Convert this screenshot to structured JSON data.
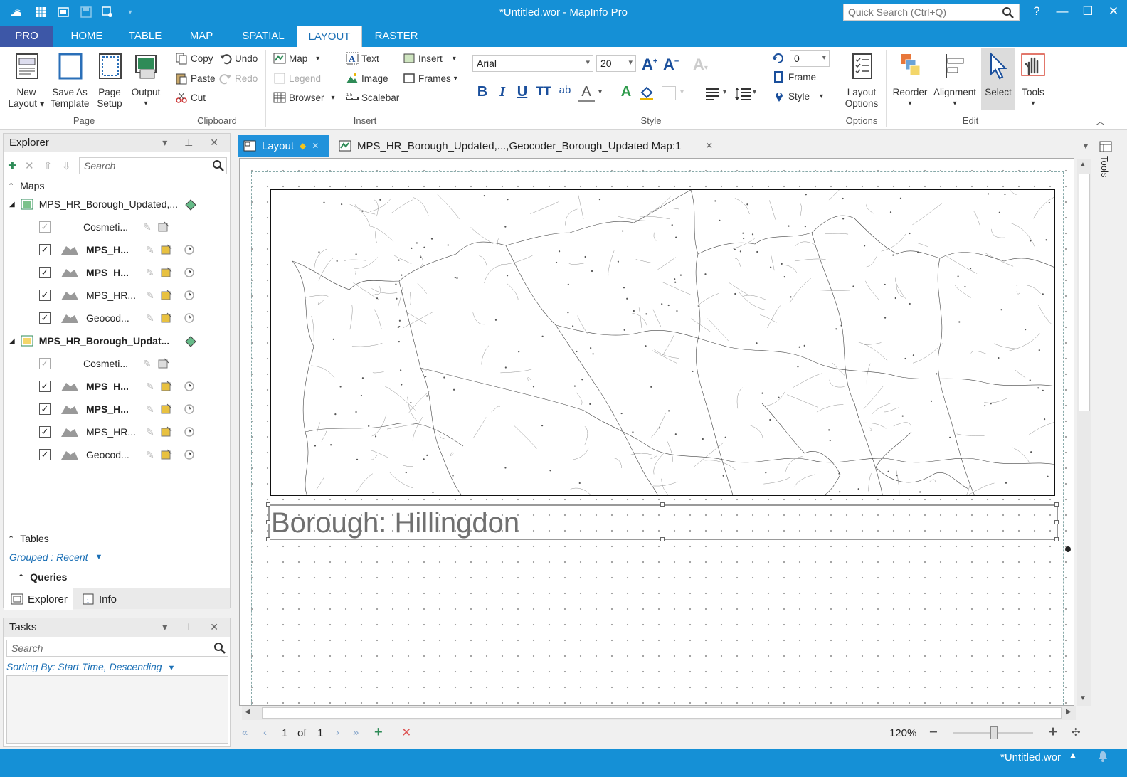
{
  "window": {
    "title": "*Untitled.wor - MapInfo Pro",
    "quick_search_placeholder": "Quick Search (Ctrl+Q)",
    "help": "?",
    "minimize": "—",
    "maximize": "☐",
    "close": "✕"
  },
  "ribbon_tabs": [
    "PRO",
    "HOME",
    "TABLE",
    "MAP",
    "SPATIAL",
    "LAYOUT",
    "RASTER"
  ],
  "ribbon": {
    "page": {
      "label": "Page",
      "new_layout_1": "New",
      "new_layout_2": "Layout",
      "save_template_1": "Save As",
      "save_template_2": "Template",
      "page_setup_1": "Page",
      "page_setup_2": "Setup",
      "output": "Output"
    },
    "clipboard": {
      "label": "Clipboard",
      "copy": "Copy",
      "paste": "Paste",
      "cut": "Cut",
      "undo": "Undo",
      "redo": "Redo"
    },
    "insert": {
      "label": "Insert",
      "map": "Map",
      "legend": "Legend",
      "browser": "Browser",
      "text": "Text",
      "image": "Image",
      "scalebar": "Scalebar",
      "insert": "Insert",
      "frames": "Frames"
    },
    "style": {
      "label": "Style",
      "font": "Arial",
      "size": "20"
    },
    "rotate": {
      "angle": "0",
      "frame": "Frame",
      "style": "Style"
    },
    "options": {
      "label": "Options",
      "layout_options_1": "Layout",
      "layout_options_2": "Options"
    },
    "edit": {
      "label": "Edit",
      "reorder": "Reorder",
      "alignment": "Alignment",
      "select": "Select",
      "tools": "Tools"
    }
  },
  "explorer": {
    "title": "Explorer",
    "search_placeholder": "Search",
    "maps_header": "Maps",
    "maps": [
      {
        "name": "MPS_HR_Borough_Updated,...",
        "bold": false,
        "layers": [
          {
            "name": "Cosmeti...",
            "checked": true,
            "gray": true,
            "bold": false
          },
          {
            "name": "MPS_H...",
            "checked": true,
            "gray": false,
            "bold": true
          },
          {
            "name": "MPS_H...",
            "checked": true,
            "gray": false,
            "bold": true
          },
          {
            "name": "MPS_HR...",
            "checked": true,
            "gray": false,
            "bold": false
          },
          {
            "name": "Geocod...",
            "checked": true,
            "gray": false,
            "bold": false
          }
        ]
      },
      {
        "name": "MPS_HR_Borough_Updat...",
        "bold": true,
        "layers": [
          {
            "name": "Cosmeti...",
            "checked": true,
            "gray": true,
            "bold": false
          },
          {
            "name": "MPS_H...",
            "checked": true,
            "gray": false,
            "bold": true
          },
          {
            "name": "MPS_H...",
            "checked": true,
            "gray": false,
            "bold": true
          },
          {
            "name": "MPS_HR...",
            "checked": true,
            "gray": false,
            "bold": false
          },
          {
            "name": "Geocod...",
            "checked": true,
            "gray": false,
            "bold": false
          }
        ]
      }
    ],
    "tables_header": "Tables",
    "grouped": "Grouped : Recent",
    "queries_header": "Queries",
    "tab_explorer": "Explorer",
    "tab_info": "Info"
  },
  "tasks": {
    "title": "Tasks",
    "search_placeholder": "Search",
    "sorting": "Sorting By: Start Time, Descending"
  },
  "doc_tabs": [
    {
      "label": "Layout",
      "active": true
    },
    {
      "label": "MPS_HR_Borough_Updated,...,Geocoder_Borough_Updated Map:1",
      "active": false
    }
  ],
  "layout": {
    "text_frame": "Borough: Hillingdon"
  },
  "nav": {
    "page": "1",
    "of": "of",
    "total": "1",
    "zoom": "120%"
  },
  "side_panel": {
    "tools": "Tools"
  },
  "status": {
    "workspace": "*Untitled.wor"
  },
  "colors": {
    "accent": "#1590d6",
    "pro": "#3d57a7",
    "active_tab": "#2192db"
  }
}
